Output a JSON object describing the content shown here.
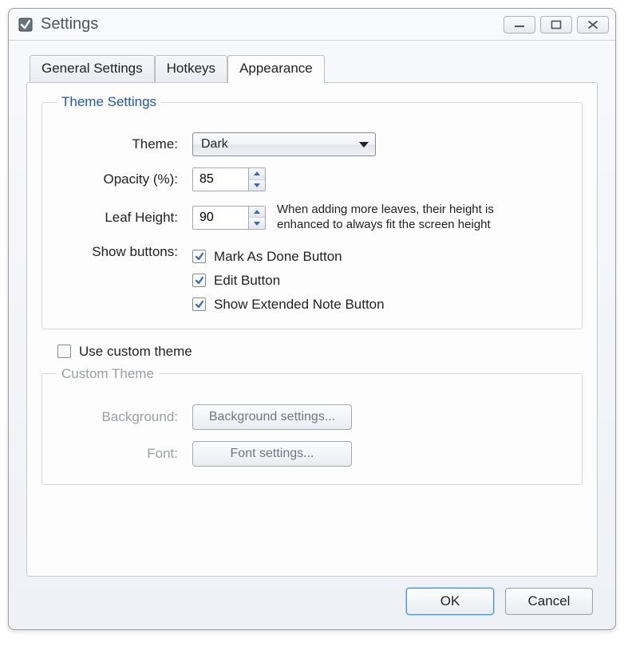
{
  "window": {
    "title": "Settings"
  },
  "tabs": {
    "general": "General Settings",
    "hotkeys": "Hotkeys",
    "appearance": "Appearance"
  },
  "themeSettings": {
    "legend": "Theme Settings",
    "themeLabel": "Theme:",
    "themeValue": "Dark",
    "opacityLabel": "Opacity (%):",
    "opacityValue": "85",
    "leafHeightLabel": "Leaf Height:",
    "leafHeightValue": "90",
    "leafHeightHint": "When adding more leaves, their height is enhanced to always fit the screen height",
    "showButtonsLabel": "Show buttons:",
    "cbMarkDone": "Mark As Done Button",
    "cbEdit": "Edit Button",
    "cbExtNote": "Show Extended Note Button"
  },
  "useCustomTheme": "Use custom theme",
  "customTheme": {
    "legend": "Custom Theme",
    "backgroundLabel": "Background:",
    "backgroundBtn": "Background settings...",
    "fontLabel": "Font:",
    "fontBtn": "Font settings..."
  },
  "footer": {
    "ok": "OK",
    "cancel": "Cancel"
  }
}
